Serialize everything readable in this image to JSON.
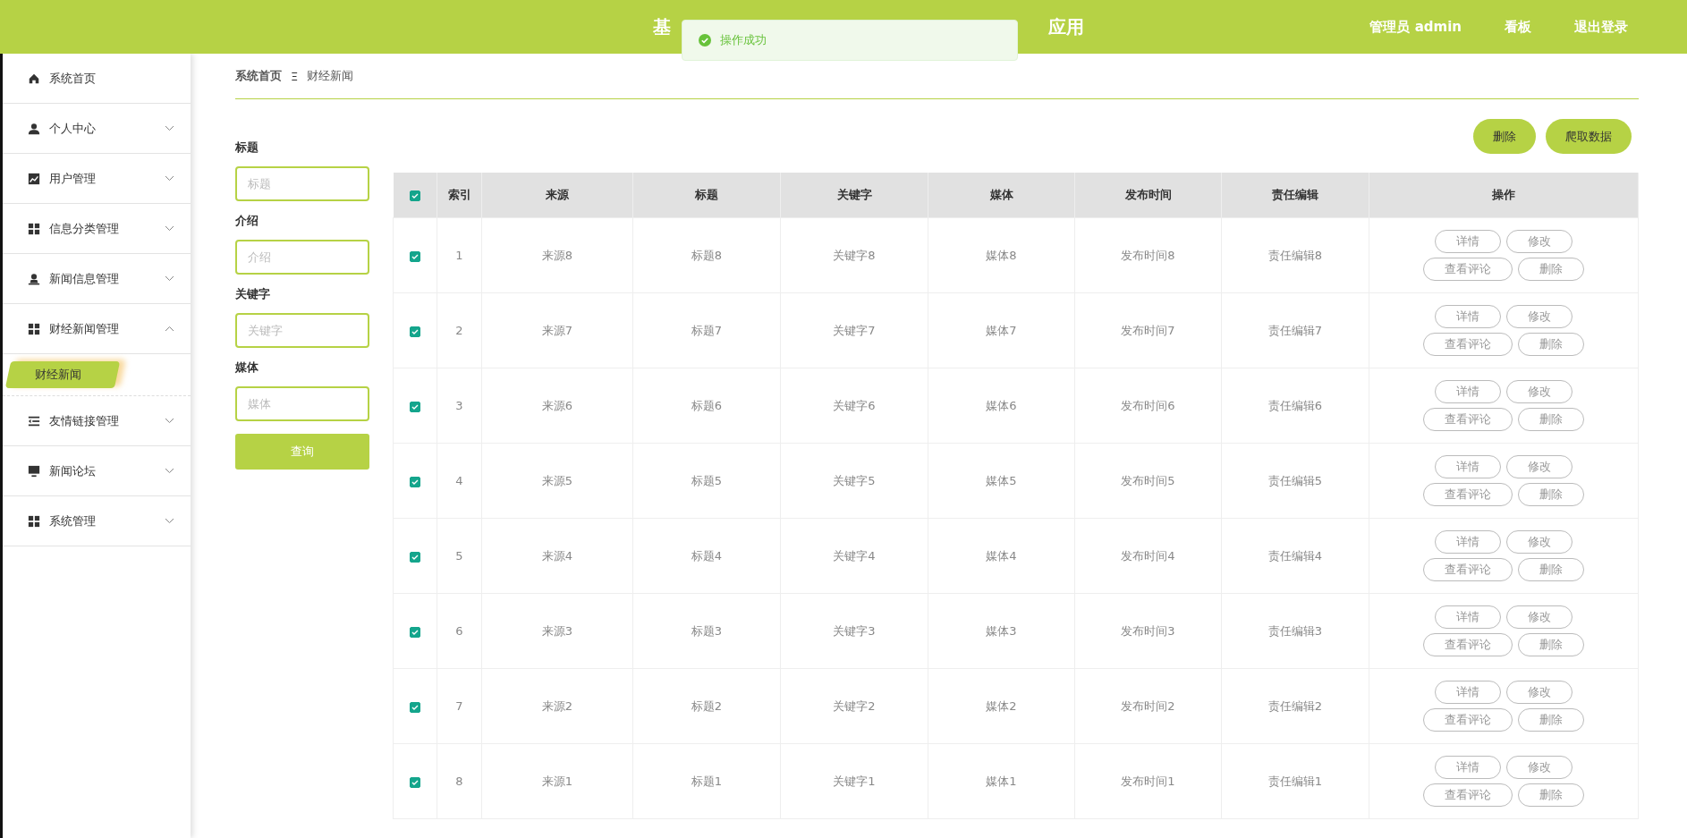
{
  "header": {
    "title_start": "基",
    "title_end": "应用",
    "user": "管理员 admin",
    "links": [
      "看板",
      "退出登录"
    ]
  },
  "toast": {
    "kind": "success",
    "message": "操作成功"
  },
  "sidebar": {
    "items": [
      {
        "label": "系统首页",
        "kind": "home"
      },
      {
        "label": "个人中心",
        "kind": "user",
        "expanded": false
      },
      {
        "label": "用户管理",
        "kind": "chart",
        "expanded": false
      },
      {
        "label": "信息分类管理",
        "kind": "grid",
        "expanded": false
      },
      {
        "label": "新闻信息管理",
        "kind": "stamp",
        "expanded": false
      },
      {
        "label": "财经新闻管理",
        "kind": "grid",
        "expanded": true,
        "children": [
          {
            "label": "财经新闻",
            "selected": true
          }
        ]
      },
      {
        "label": "友情链接管理",
        "kind": "list",
        "expanded": false
      },
      {
        "label": "新闻论坛",
        "kind": "monitor",
        "expanded": false
      },
      {
        "label": "系统管理",
        "kind": "grid",
        "expanded": false
      }
    ]
  },
  "breadcrumb": {
    "items": [
      "系统首页",
      "财经新闻"
    ],
    "separator": "Ξ"
  },
  "search_form": {
    "fields": [
      {
        "label": "标题",
        "placeholder": "标题"
      },
      {
        "label": "介绍",
        "placeholder": "介绍"
      },
      {
        "label": "关键字",
        "placeholder": "关键字"
      },
      {
        "label": "媒体",
        "placeholder": "媒体"
      }
    ],
    "button": "查询"
  },
  "toolbar": {
    "buttons": [
      "删除",
      "爬取数据"
    ]
  },
  "table": {
    "all_checked": true,
    "columns": [
      "索引",
      "来源",
      "标题",
      "关键字",
      "媒体",
      "发布时间",
      "责任编辑",
      "操作"
    ],
    "rows": [
      {
        "checked": true,
        "cells": [
          "1",
          "来源8",
          "标题8",
          "关键字8",
          "媒体8",
          "发布时间8",
          "责任编辑8"
        ],
        "actions": [
          [
            "详情",
            "修改"
          ],
          [
            "查看评论",
            "删除"
          ]
        ]
      },
      {
        "checked": true,
        "cells": [
          "2",
          "来源7",
          "标题7",
          "关键字7",
          "媒体7",
          "发布时间7",
          "责任编辑7"
        ],
        "actions": [
          [
            "详情",
            "修改"
          ],
          [
            "查看评论",
            "删除"
          ]
        ]
      },
      {
        "checked": true,
        "cells": [
          "3",
          "来源6",
          "标题6",
          "关键字6",
          "媒体6",
          "发布时间6",
          "责任编辑6"
        ],
        "actions": [
          [
            "详情",
            "修改"
          ],
          [
            "查看评论",
            "删除"
          ]
        ]
      },
      {
        "checked": true,
        "cells": [
          "4",
          "来源5",
          "标题5",
          "关键字5",
          "媒体5",
          "发布时间5",
          "责任编辑5"
        ],
        "actions": [
          [
            "详情",
            "修改"
          ],
          [
            "查看评论",
            "删除"
          ]
        ]
      },
      {
        "checked": true,
        "cells": [
          "5",
          "来源4",
          "标题4",
          "关键字4",
          "媒体4",
          "发布时间4",
          "责任编辑4"
        ],
        "actions": [
          [
            "详情",
            "修改"
          ],
          [
            "查看评论",
            "删除"
          ]
        ]
      },
      {
        "checked": true,
        "cells": [
          "6",
          "来源3",
          "标题3",
          "关键字3",
          "媒体3",
          "发布时间3",
          "责任编辑3"
        ],
        "actions": [
          [
            "详情",
            "修改"
          ],
          [
            "查看评论",
            "删除"
          ]
        ]
      },
      {
        "checked": true,
        "cells": [
          "7",
          "来源2",
          "标题2",
          "关键字2",
          "媒体2",
          "发布时间2",
          "责任编辑2"
        ],
        "actions": [
          [
            "详情",
            "修改"
          ],
          [
            "查看评论",
            "删除"
          ]
        ]
      },
      {
        "checked": true,
        "cells": [
          "8",
          "来源1",
          "标题1",
          "关键字1",
          "媒体1",
          "发布时间1",
          "责任编辑1"
        ],
        "actions": [
          [
            "详情",
            "修改"
          ],
          [
            "查看评论",
            "删除"
          ]
        ]
      }
    ]
  }
}
